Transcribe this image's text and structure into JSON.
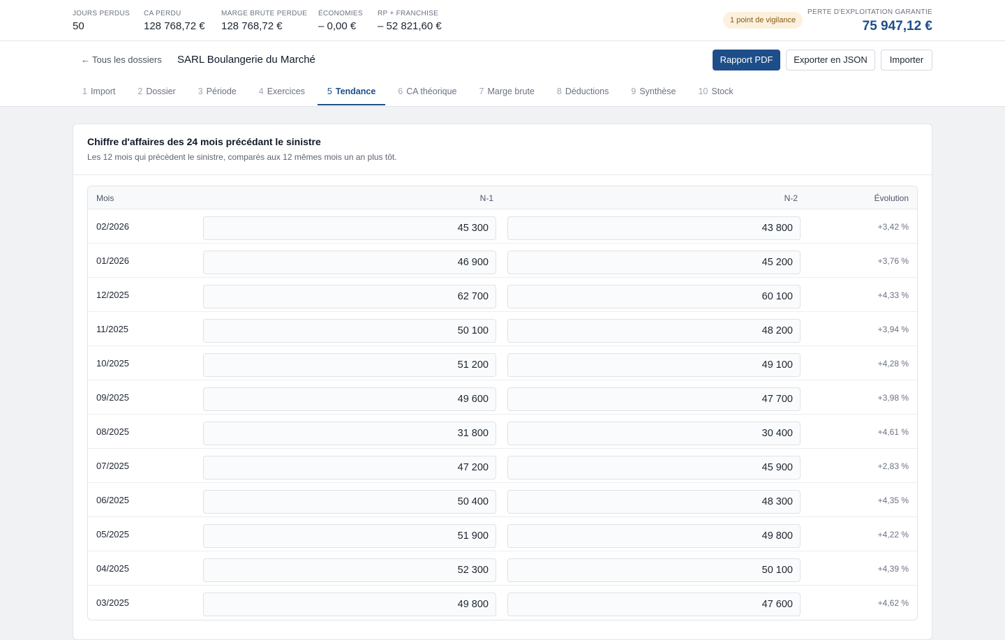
{
  "kpis": [
    {
      "label": "JOURS PERDUS",
      "value": "50"
    },
    {
      "label": "CA PERDU",
      "value": "128 768,72 €"
    },
    {
      "label": "MARGE BRUTE PERDUE",
      "value": "128 768,72 €"
    },
    {
      "label": "ÉCONOMIES",
      "value": "– 0,00 €"
    },
    {
      "label": "RP + FRANCHISE",
      "value": "– 52 821,60 €"
    }
  ],
  "vigilance": "1 point de vigilance",
  "guarantee": {
    "label": "PERTE D'EXPLOITATION GARANTIE",
    "value": "75 947,12 €"
  },
  "header": {
    "back_arrow": "←",
    "back_label": "Tous les dossiers",
    "case_title": "SARL Boulangerie du Marché",
    "btn_pdf": "Rapport PDF",
    "btn_export": "Exporter en JSON",
    "btn_import": "Importer"
  },
  "tabs": [
    {
      "num": "1",
      "label": "Import"
    },
    {
      "num": "2",
      "label": "Dossier"
    },
    {
      "num": "3",
      "label": "Période"
    },
    {
      "num": "4",
      "label": "Exercices"
    },
    {
      "num": "5",
      "label": "Tendance",
      "active": true
    },
    {
      "num": "6",
      "label": "CA théorique"
    },
    {
      "num": "7",
      "label": "Marge brute"
    },
    {
      "num": "8",
      "label": "Déductions"
    },
    {
      "num": "9",
      "label": "Synthèse"
    },
    {
      "num": "10",
      "label": "Stock"
    }
  ],
  "card": {
    "title": "Chiffre d'affaires des 24 mois précédant le sinistre",
    "subtitle": "Les 12 mois qui précèdent le sinistre, comparés aux 12 mêmes mois un an plus tôt."
  },
  "table": {
    "headers": {
      "month": "Mois",
      "n1": "N-1",
      "n2": "N-2",
      "evolution": "Évolution"
    },
    "rows": [
      {
        "month": "02/2026",
        "n1": "45 300",
        "n2": "43 800",
        "evolution": "+3,42 %"
      },
      {
        "month": "01/2026",
        "n1": "46 900",
        "n2": "45 200",
        "evolution": "+3,76 %"
      },
      {
        "month": "12/2025",
        "n1": "62 700",
        "n2": "60 100",
        "evolution": "+4,33 %"
      },
      {
        "month": "11/2025",
        "n1": "50 100",
        "n2": "48 200",
        "evolution": "+3,94 %"
      },
      {
        "month": "10/2025",
        "n1": "51 200",
        "n2": "49 100",
        "evolution": "+4,28 %"
      },
      {
        "month": "09/2025",
        "n1": "49 600",
        "n2": "47 700",
        "evolution": "+3,98 %"
      },
      {
        "month": "08/2025",
        "n1": "31 800",
        "n2": "30 400",
        "evolution": "+4,61 %"
      },
      {
        "month": "07/2025",
        "n1": "47 200",
        "n2": "45 900",
        "evolution": "+2,83 %"
      },
      {
        "month": "06/2025",
        "n1": "50 400",
        "n2": "48 300",
        "evolution": "+4,35 %"
      },
      {
        "month": "05/2025",
        "n1": "51 900",
        "n2": "49 800",
        "evolution": "+4,22 %"
      },
      {
        "month": "04/2025",
        "n1": "52 300",
        "n2": "50 100",
        "evolution": "+4,39 %"
      },
      {
        "month": "03/2025",
        "n1": "49 800",
        "n2": "47 600",
        "evolution": "+4,62 %"
      }
    ]
  }
}
